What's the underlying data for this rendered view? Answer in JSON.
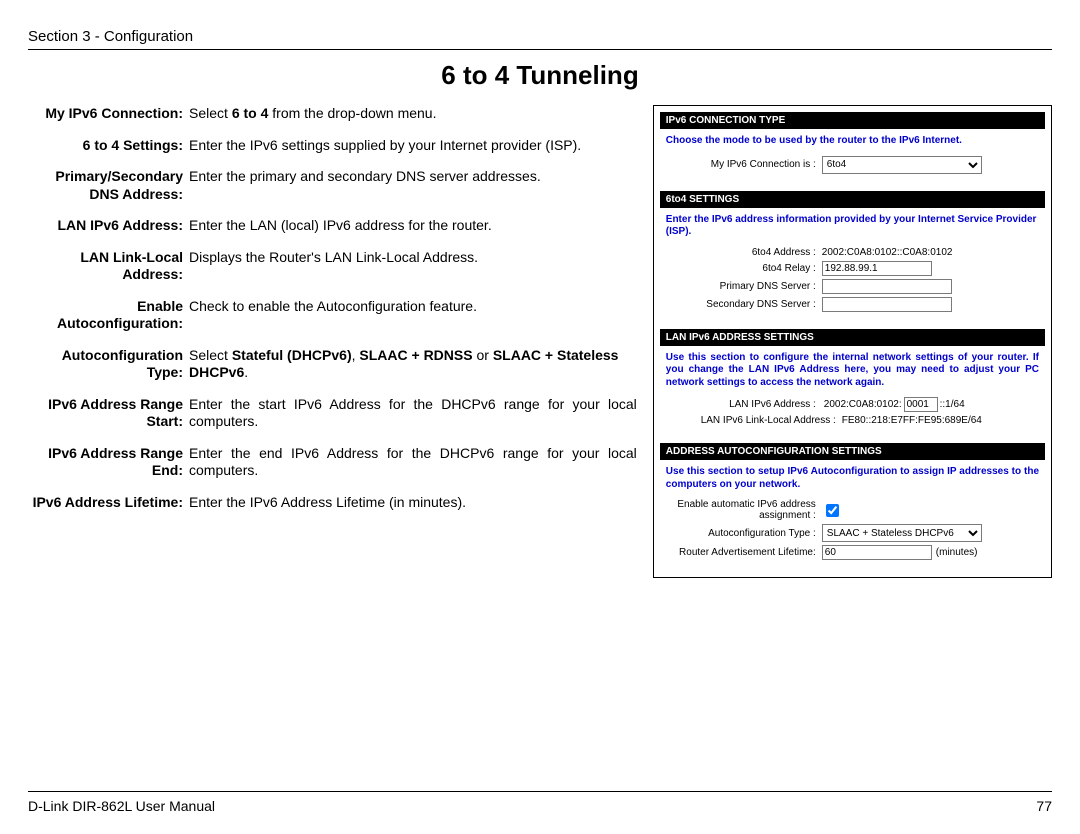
{
  "header": {
    "section": "Section 3 - Configuration"
  },
  "title": "6 to 4 Tunneling",
  "defs": [
    {
      "term": "My IPv6 Connection:",
      "pre": "Select ",
      "bold": "6 to 4",
      "post": " from the drop-down menu."
    },
    {
      "term": "6 to 4 Settings:",
      "desc": "Enter the IPv6 settings supplied by your Internet provider (ISP)."
    },
    {
      "term": "Primary/Secondary DNS Address:",
      "desc": "Enter the primary and secondary DNS server addresses."
    },
    {
      "term": "LAN IPv6 Address:",
      "desc": "Enter the LAN (local) IPv6 address for the router."
    },
    {
      "term": "LAN Link-Local Address:",
      "desc": "Displays the Router's LAN Link-Local Address."
    },
    {
      "term": "Enable Autoconfiguration:",
      "desc": "Check to enable the Autoconfiguration feature."
    },
    {
      "term": "Autoconfiguration Type:",
      "pre": "Select ",
      "bold": "Stateful (DHCPv6)",
      "mid1": ", ",
      "bold2": "SLAAC + RDNSS",
      "mid2": " or ",
      "bold3": "SLAAC + Stateless DHCPv6",
      "post": "."
    },
    {
      "term": "IPv6 Address Range Start:",
      "desc": "Enter the start IPv6 Address for the DHCPv6 range for your local computers.",
      "justify": true
    },
    {
      "term": "IPv6 Address Range End:",
      "desc": "Enter the end IPv6 Address for the DHCPv6 range for your local computers.",
      "justify": true
    },
    {
      "term": "IPv6 Address Lifetime:",
      "desc": "Enter the IPv6 Address Lifetime (in minutes)."
    }
  ],
  "panel": {
    "connection": {
      "header": "IPv6 CONNECTION TYPE",
      "help": "Choose the mode to be used by the router to the IPv6 Internet.",
      "label": "My IPv6 Connection is :",
      "value": "6to4"
    },
    "sixto4": {
      "header": "6to4 SETTINGS",
      "help": "Enter the IPv6 address information provided by your Internet Service Provider (ISP).",
      "addr_label": "6to4 Address :",
      "addr_value": "2002:C0A8:0102::C0A8:0102",
      "relay_label": "6to4 Relay :",
      "relay_value": "192.88.99.1",
      "pdns_label": "Primary DNS Server :",
      "pdns_value": "",
      "sdns_label": "Secondary DNS Server :",
      "sdns_value": ""
    },
    "lan": {
      "header": "LAN IPv6 ADDRESS SETTINGS",
      "help": "Use this section to configure the internal network settings of your router. If you change the LAN IPv6 Address here, you may need to adjust your PC network settings to access the network again.",
      "ipv6_label": "LAN IPv6 Address :",
      "ipv6_prefix": "2002:C0A8:0102:",
      "ipv6_value": "0001",
      "ipv6_suffix": "::1/64",
      "ll_label": "LAN IPv6 Link-Local Address :",
      "ll_value": "FE80::218:E7FF:FE95:689E/64"
    },
    "auto": {
      "header": "ADDRESS AUTOCONFIGURATION SETTINGS",
      "help": "Use this section to setup IPv6 Autoconfiguration to assign IP addresses to the computers on your network.",
      "enable_label": "Enable automatic IPv6 address assignment :",
      "type_label": "Autoconfiguration Type :",
      "type_value": "SLAAC + Stateless DHCPv6",
      "life_label": "Router Advertisement Lifetime:",
      "life_value": "60",
      "life_unit": "(minutes)"
    }
  },
  "footer": {
    "left": "D-Link DIR-862L User Manual",
    "right": "77"
  }
}
